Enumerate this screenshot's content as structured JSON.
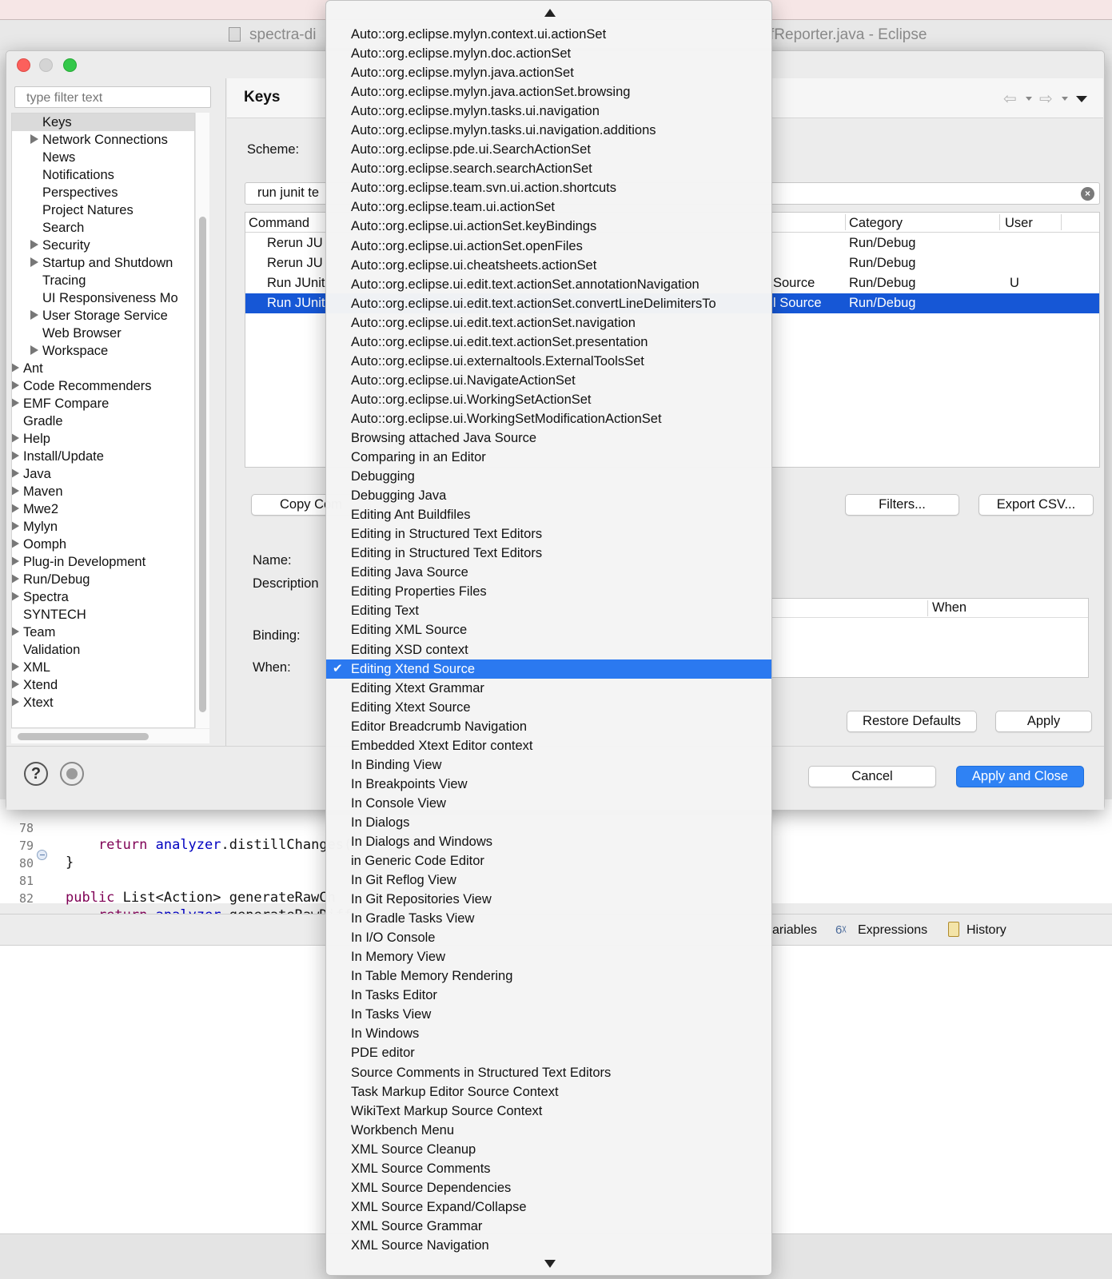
{
  "window": {
    "title_left": "spectra-di",
    "title_right": "fReporter.java - Eclipse"
  },
  "code": [
    {
      "line": "78",
      "text": "    return analyzer.distillChanges("
    },
    {
      "line": "79",
      "text": "}"
    },
    {
      "line": "80",
      "text": ""
    },
    {
      "line": "81",
      "text": "public List<Action> generateRawCh"
    },
    {
      "line": "82",
      "text": "    return analyzer.generateRawDiff"
    }
  ],
  "views": {
    "variables": "ariables",
    "expressions": "Expressions",
    "history": "History"
  },
  "preferences": {
    "filter_placeholder": "type filter text",
    "tree": [
      {
        "label": "Keys",
        "indent": 1,
        "arrow": false,
        "selected": true
      },
      {
        "label": "Network Connections",
        "indent": 1,
        "arrow": true
      },
      {
        "label": "News",
        "indent": 1,
        "arrow": false
      },
      {
        "label": "Notifications",
        "indent": 1,
        "arrow": false
      },
      {
        "label": "Perspectives",
        "indent": 1,
        "arrow": false
      },
      {
        "label": "Project Natures",
        "indent": 1,
        "arrow": false
      },
      {
        "label": "Search",
        "indent": 1,
        "arrow": false
      },
      {
        "label": "Security",
        "indent": 1,
        "arrow": true
      },
      {
        "label": "Startup and Shutdown",
        "indent": 1,
        "arrow": true
      },
      {
        "label": "Tracing",
        "indent": 1,
        "arrow": false
      },
      {
        "label": "UI Responsiveness Mo",
        "indent": 1,
        "arrow": false
      },
      {
        "label": "User Storage Service",
        "indent": 1,
        "arrow": true
      },
      {
        "label": "Web Browser",
        "indent": 1,
        "arrow": false
      },
      {
        "label": "Workspace",
        "indent": 1,
        "arrow": true
      },
      {
        "label": "Ant",
        "indent": 0,
        "arrow": true
      },
      {
        "label": "Code Recommenders",
        "indent": 0,
        "arrow": true
      },
      {
        "label": "EMF Compare",
        "indent": 0,
        "arrow": true
      },
      {
        "label": "Gradle",
        "indent": 0,
        "arrow": false
      },
      {
        "label": "Help",
        "indent": 0,
        "arrow": true
      },
      {
        "label": "Install/Update",
        "indent": 0,
        "arrow": true
      },
      {
        "label": "Java",
        "indent": 0,
        "arrow": true
      },
      {
        "label": "Maven",
        "indent": 0,
        "arrow": true
      },
      {
        "label": "Mwe2",
        "indent": 0,
        "arrow": true
      },
      {
        "label": "Mylyn",
        "indent": 0,
        "arrow": true
      },
      {
        "label": "Oomph",
        "indent": 0,
        "arrow": true
      },
      {
        "label": "Plug-in Development",
        "indent": 0,
        "arrow": true
      },
      {
        "label": "Run/Debug",
        "indent": 0,
        "arrow": true
      },
      {
        "label": "Spectra",
        "indent": 0,
        "arrow": true
      },
      {
        "label": "SYNTECH",
        "indent": 0,
        "arrow": false
      },
      {
        "label": "Team",
        "indent": 0,
        "arrow": true
      },
      {
        "label": "Validation",
        "indent": 0,
        "arrow": false
      },
      {
        "label": "XML",
        "indent": 0,
        "arrow": true
      },
      {
        "label": "Xtend",
        "indent": 0,
        "arrow": true
      },
      {
        "label": "Xtext",
        "indent": 0,
        "arrow": true
      }
    ],
    "page_title": "Keys",
    "scheme_label": "Scheme:",
    "search_value": "run junit te",
    "columns": {
      "command": "Command",
      "category": "Category",
      "user": "User"
    },
    "rows": [
      {
        "command": "Rerun JU",
        "when": "",
        "category": "Run/Debug",
        "user": "",
        "selected": false
      },
      {
        "command": "Rerun JU",
        "when": "",
        "category": "Run/Debug",
        "user": "",
        "selected": false
      },
      {
        "command": "Run JUnit",
        "when": "Source",
        "category": "Run/Debug",
        "user": "U",
        "selected": false
      },
      {
        "command": "Run JUnit",
        "when": "l Source",
        "category": "Run/Debug",
        "user": "",
        "selected": true
      }
    ],
    "buttons": {
      "copy_command": "Copy Com",
      "filters": "Filters...",
      "export_csv": "Export CSV...",
      "restore_defaults": "Restore Defaults",
      "apply": "Apply",
      "cancel": "Cancel",
      "apply_close": "Apply and Close"
    },
    "labels": {
      "name": "Name:",
      "description": "Description",
      "binding": "Binding:",
      "when": "When:",
      "when_column": "When"
    }
  },
  "dropdown": {
    "selected_index": 33,
    "items": [
      "Auto::org.eclipse.mylyn.context.ui.actionSet",
      "Auto::org.eclipse.mylyn.doc.actionSet",
      "Auto::org.eclipse.mylyn.java.actionSet",
      "Auto::org.eclipse.mylyn.java.actionSet.browsing",
      "Auto::org.eclipse.mylyn.tasks.ui.navigation",
      "Auto::org.eclipse.mylyn.tasks.ui.navigation.additions",
      "Auto::org.eclipse.pde.ui.SearchActionSet",
      "Auto::org.eclipse.search.searchActionSet",
      "Auto::org.eclipse.team.svn.ui.action.shortcuts",
      "Auto::org.eclipse.team.ui.actionSet",
      "Auto::org.eclipse.ui.actionSet.keyBindings",
      "Auto::org.eclipse.ui.actionSet.openFiles",
      "Auto::org.eclipse.ui.cheatsheets.actionSet",
      "Auto::org.eclipse.ui.edit.text.actionSet.annotationNavigation",
      "Auto::org.eclipse.ui.edit.text.actionSet.convertLineDelimitersTo",
      "Auto::org.eclipse.ui.edit.text.actionSet.navigation",
      "Auto::org.eclipse.ui.edit.text.actionSet.presentation",
      "Auto::org.eclipse.ui.externaltools.ExternalToolsSet",
      "Auto::org.eclipse.ui.NavigateActionSet",
      "Auto::org.eclipse.ui.WorkingSetActionSet",
      "Auto::org.eclipse.ui.WorkingSetModificationActionSet",
      "Browsing attached Java Source",
      "Comparing in an Editor",
      "Debugging",
      "Debugging Java",
      "Editing Ant Buildfiles",
      "Editing in Structured Text Editors",
      "Editing in Structured Text Editors",
      "Editing Java Source",
      "Editing Properties Files",
      "Editing Text",
      "Editing XML Source",
      "Editing XSD context",
      "Editing Xtend Source",
      "Editing Xtext Grammar",
      "Editing Xtext Source",
      "Editor Breadcrumb Navigation",
      "Embedded Xtext Editor context",
      "In Binding View",
      "In Breakpoints View",
      "In Console View",
      "In Dialogs",
      "In Dialogs and Windows",
      "in Generic Code Editor",
      "In Git Reflog View",
      "In Git Repositories View",
      "In Gradle Tasks View",
      "In I/O Console",
      "In Memory View",
      "In Table Memory Rendering",
      "In Tasks Editor",
      "In Tasks View",
      "In Windows",
      "PDE editor",
      "Source Comments in Structured Text Editors",
      "Task Markup Editor Source Context",
      "WikiText Markup Source Context",
      "Workbench Menu",
      "XML Source Cleanup",
      "XML Source Comments",
      "XML Source Dependencies",
      "XML Source Expand/Collapse",
      "XML Source Grammar",
      "XML Source Navigation"
    ]
  }
}
